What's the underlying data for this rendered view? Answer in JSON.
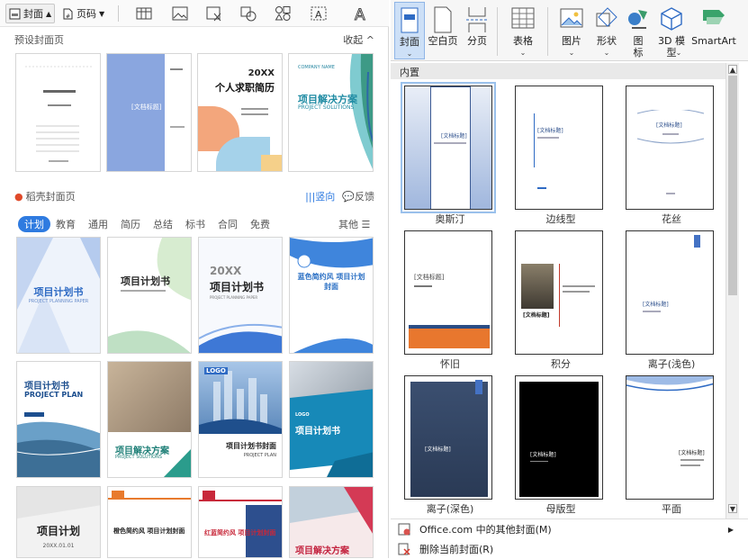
{
  "left_toolbar": {
    "cover_label": "封面",
    "page_number_label": "页码"
  },
  "preset_section": {
    "title": "预设封面页",
    "collapse_label": "收起"
  },
  "preset_cards": [
    {
      "title": ""
    },
    {
      "title": "[文档标题]"
    },
    {
      "title_year": "20XX",
      "title": "个人求职简历"
    },
    {
      "title": "项目解决方案",
      "subtitle": "PROJECT SOLUTIONS"
    }
  ],
  "docer_section": {
    "title": "稻壳封面页",
    "vertical_label": "竖向",
    "feedback_label": "反馈"
  },
  "category_tabs": [
    "计划",
    "教育",
    "通用",
    "简历",
    "总结",
    "标书",
    "合同",
    "免费"
  ],
  "other_label": "其他",
  "template_cards": [
    {
      "title": "项目计划书",
      "subtitle": "PROJECT PLANNING PAPER"
    },
    {
      "title": "项目计划书",
      "subtitle": ""
    },
    {
      "year": "20XX",
      "title": "项目计划书",
      "subtitle": "PROJECT PLANNING PAPER"
    },
    {
      "title": "蓝色简约风 项目计划封面",
      "subtitle": ""
    },
    {
      "title": "项目计划书",
      "subtitle": "PROJECT PLAN"
    },
    {
      "title": "项目解决方案",
      "subtitle": "PROJECT SOLUTIONS"
    },
    {
      "logo": "LOGO",
      "title": "项目计划书封面",
      "subtitle": "PROJECT PLAN"
    },
    {
      "title": "项目计划书",
      "subtitle": ""
    },
    {
      "title": "项目计划",
      "subtitle": "20XX.01.01"
    },
    {
      "title": "橙色简约风 项目计划封面",
      "subtitle": ""
    },
    {
      "title": "红蓝简约风 项目计划封面",
      "subtitle": ""
    },
    {
      "title": "项目解决方案",
      "subtitle": ""
    }
  ],
  "ribbon": [
    {
      "label": "封面"
    },
    {
      "label": "空白页"
    },
    {
      "label": "分页"
    },
    {
      "label": "表格"
    },
    {
      "label": "图片"
    },
    {
      "label": "形状"
    },
    {
      "label": "图标"
    },
    {
      "label": "3D 模型"
    },
    {
      "label": "SmartArt"
    }
  ],
  "gallery": {
    "header": "内置",
    "items": [
      {
        "name": "奥斯汀",
        "placeholder": "[文档标题]"
      },
      {
        "name": "边线型",
        "placeholder": "[文档标题]"
      },
      {
        "name": "花丝",
        "placeholder": "[文档标题]"
      },
      {
        "name": "怀旧",
        "placeholder": "[文档标题]"
      },
      {
        "name": "积分",
        "placeholder": "[文档标题]"
      },
      {
        "name": "离子(浅色)",
        "placeholder": "[文档标题]"
      },
      {
        "name": "离子(深色)",
        "placeholder": "[文档标题]"
      },
      {
        "name": "母版型",
        "placeholder": "[文档标题]"
      },
      {
        "name": "平面",
        "placeholder": "[文档标题]"
      }
    ]
  },
  "menu": {
    "more_covers": "Office.com 中的其他封面(M)",
    "remove_cover": "删除当前封面(R)"
  },
  "colors": {
    "accent": "#2f7be0",
    "ribbon_selected": "#cde0f7"
  }
}
